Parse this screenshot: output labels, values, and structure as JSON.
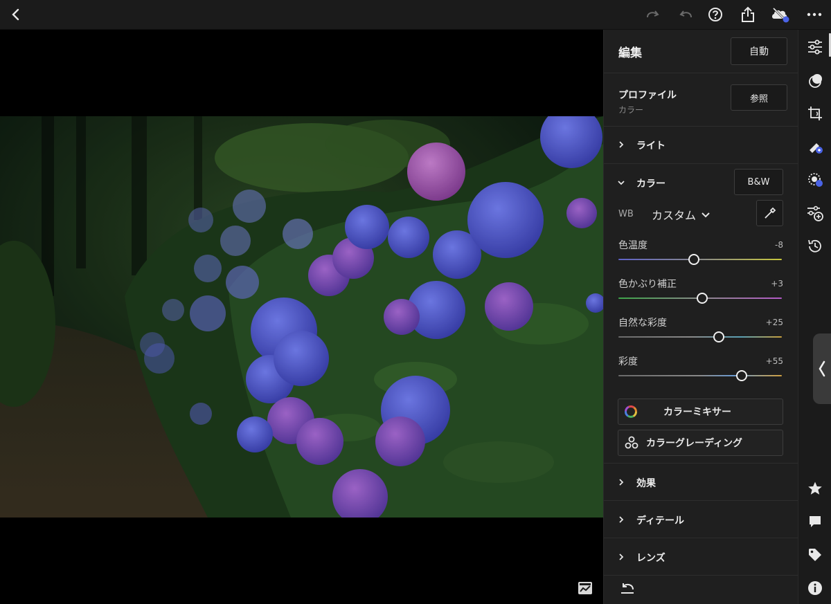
{
  "editor": {
    "title": "編集",
    "auto_label": "自動",
    "profile": {
      "title": "プロファイル",
      "value": "カラー",
      "browse_label": "参照"
    },
    "sections": {
      "light": "ライト",
      "color": "カラー",
      "effects": "効果",
      "detail": "ディテール",
      "lens": "レンズ"
    },
    "color": {
      "bw_label": "B&W",
      "wb_label": "WB",
      "wb_value": "カスタム",
      "sliders": {
        "temp": {
          "label": "色温度",
          "value": "-8",
          "level": -8
        },
        "tint": {
          "label": "色かぶり補正",
          "value": "+3",
          "level": 3
        },
        "vibrance": {
          "label": "自然な彩度",
          "value": "+25",
          "level": 25
        },
        "saturation": {
          "label": "彩度",
          "value": "+55",
          "level": 55
        }
      },
      "mixer_label": "カラーミキサー",
      "grading_label": "カラーグレーディング"
    }
  },
  "topbar_icons": [
    "back-icon",
    "redo-icon",
    "undo-icon",
    "help-icon",
    "share-icon",
    "cloud-sync-icon",
    "more-icon"
  ],
  "toolstrip_icons": [
    "edit-sliders-icon",
    "masking-icon",
    "crop-icon",
    "healing-icon",
    "selective-icon",
    "presets-icon",
    "versions-icon",
    "star-icon",
    "comment-icon",
    "tag-icon",
    "info-icon"
  ],
  "colors": {
    "accent_blue": "#4a63e6",
    "panel_bg": "#1f1f1f",
    "topbar_bg": "#1b1b1b"
  }
}
